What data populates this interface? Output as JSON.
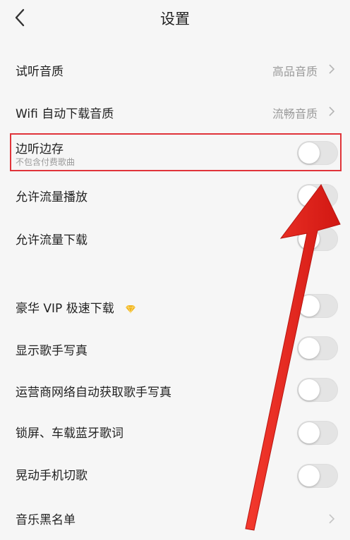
{
  "header": {
    "title": "设置"
  },
  "rows": {
    "audition_quality": {
      "label": "试听音质",
      "value": "高品音质"
    },
    "wifi_quality": {
      "label": "Wifi 自动下载音质",
      "value": "流畅音质"
    },
    "listen_save": {
      "label": "边听边存",
      "sub": "不包含付费歌曲",
      "on": false
    },
    "allow_data_play": {
      "label": "允许流量播放",
      "on": false
    },
    "allow_data_download": {
      "label": "允许流量下载",
      "on": false
    },
    "vip_download": {
      "label": "豪华 VIP 极速下载",
      "on": false
    },
    "show_photo": {
      "label": "显示歌手写真",
      "on": false
    },
    "carrier_photo": {
      "label": "运营商网络自动获取歌手写真",
      "on": false
    },
    "lock_lyrics": {
      "label": "锁屏、车载蓝牙歌词",
      "on": false
    },
    "shake_switch": {
      "label": "晃动手机切歌",
      "on": false
    },
    "blacklist": {
      "label": "音乐黑名单"
    }
  },
  "icons": {
    "back": "chevron-left-icon",
    "chevron": "chevron-right-icon",
    "vip": "diamond-icon"
  },
  "colors": {
    "background": "#f6f6f6",
    "highlight_border": "#e0343a",
    "arrow": "#e8201c",
    "vip_diamond": "#f2b51c"
  }
}
